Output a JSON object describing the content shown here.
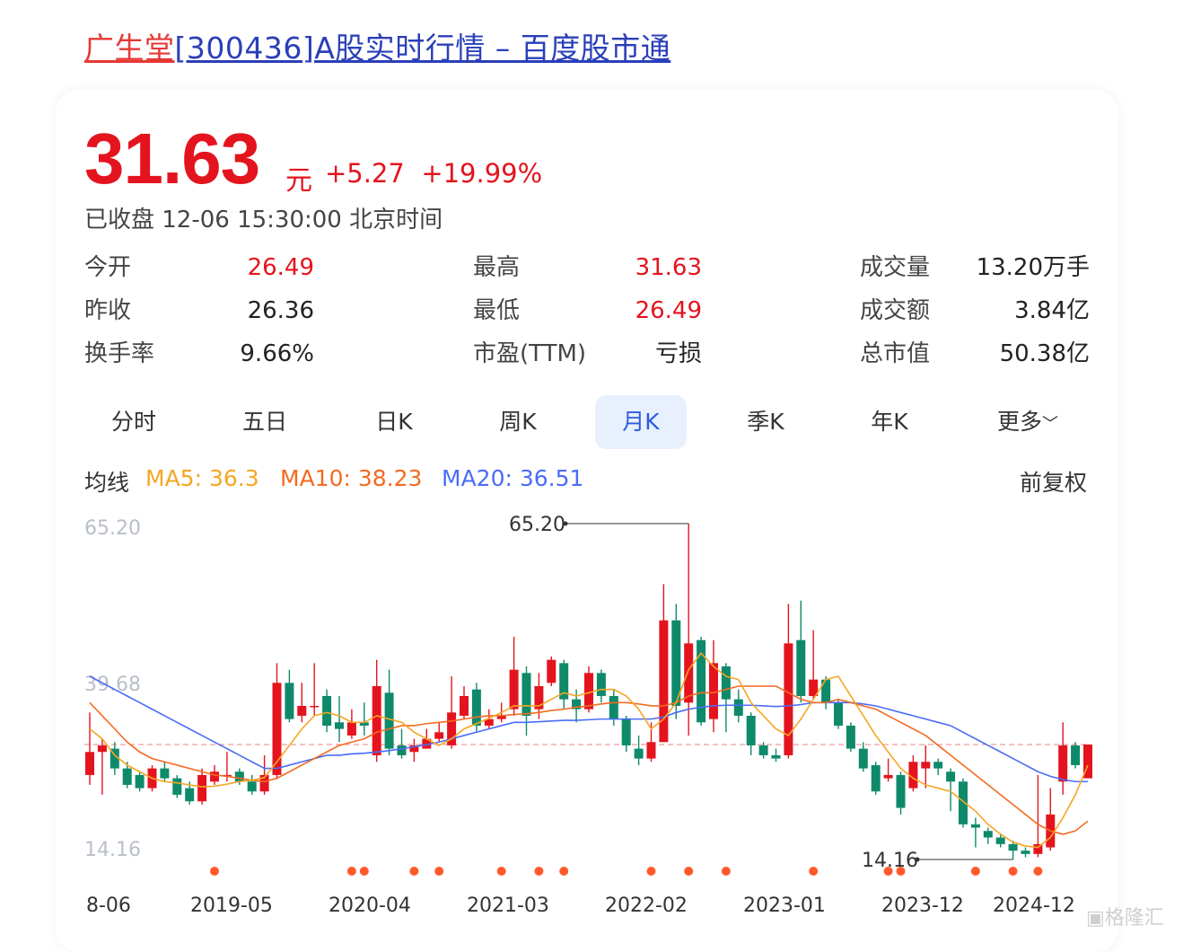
{
  "page_title": {
    "stock_name": "广生堂",
    "rest": "[300436]A股实时行情 – 百度股市通"
  },
  "quote": {
    "price": "31.63",
    "unit": "元",
    "change": "+5.27",
    "change_pct": "+19.99%",
    "status": "已收盘 12-06 15:30:00 北京时间"
  },
  "stats": [
    {
      "label": "今开",
      "value": "26.49",
      "color": "red"
    },
    {
      "label": "最高",
      "value": "31.63",
      "color": "red"
    },
    {
      "label": "成交量",
      "value": "13.20万手",
      "color": "dark"
    },
    {
      "label": "昨收",
      "value": "26.36",
      "color": "dark"
    },
    {
      "label": "最低",
      "value": "26.49",
      "color": "red"
    },
    {
      "label": "成交额",
      "value": "3.84亿",
      "color": "dark"
    },
    {
      "label": "换手率",
      "value": "9.66%",
      "color": "dark"
    },
    {
      "label": "市盈(TTM)",
      "value": "亏损",
      "color": "dark"
    },
    {
      "label": "总市值",
      "value": "50.38亿",
      "color": "dark"
    }
  ],
  "tabs": [
    "分时",
    "五日",
    "日K",
    "周K",
    "月K",
    "季K",
    "年K",
    "更多"
  ],
  "active_tab": "月K",
  "ma_bar": {
    "label": "均线",
    "ma5": "MA5: 36.3",
    "ma10": "MA10: 38.23",
    "ma20": "MA20: 36.51",
    "adjust": "前复权"
  },
  "colors": {
    "up": "#e4141e",
    "down": "#0e8a6b",
    "ma5": "#f5a623",
    "ma10": "#f36b21",
    "ma20": "#4a6cf7",
    "marker": "#ff5a2a"
  },
  "watermark": "格隆汇",
  "chart_data": {
    "type": "candlestick",
    "title": "",
    "ylim": [
      14.16,
      65.2
    ],
    "y_ticks": [
      "65.20",
      "39.68",
      "14.16"
    ],
    "x_ticks": [
      "8-06",
      "2019-05",
      "2020-04",
      "2021-03",
      "2022-02",
      "2023-01",
      "2023-12",
      "2024-12"
    ],
    "high_label": "65.20",
    "low_label": "14.16",
    "last_close": 31.63,
    "candles": [
      [
        27.0,
        30.5,
        36.5,
        25.5
      ],
      [
        30.5,
        31.5,
        32.5,
        24.0
      ],
      [
        31.0,
        28.0,
        32.0,
        27.0
      ],
      [
        28.0,
        25.5,
        29.0,
        25.0
      ],
      [
        27.0,
        25.0,
        27.5,
        24.5
      ],
      [
        25.0,
        28.0,
        28.5,
        24.5
      ],
      [
        28.0,
        26.5,
        29.0,
        26.0
      ],
      [
        26.5,
        24.0,
        27.0,
        23.5
      ],
      [
        25.0,
        23.0,
        26.0,
        22.5
      ],
      [
        23.0,
        27.0,
        28.0,
        22.5
      ],
      [
        26.0,
        27.5,
        28.5,
        25.5
      ],
      [
        27.0,
        27.0,
        30.5,
        26.0
      ],
      [
        27.5,
        26.0,
        28.0,
        25.5
      ],
      [
        26.0,
        24.5,
        27.0,
        24.0
      ],
      [
        24.5,
        27.0,
        30.0,
        24.0
      ],
      [
        27.0,
        41.0,
        44.0,
        26.5
      ],
      [
        41.0,
        35.5,
        43.0,
        35.0
      ],
      [
        36.0,
        37.5,
        41.0,
        35.0
      ],
      [
        37.5,
        37.5,
        44.0,
        36.0
      ],
      [
        39.0,
        34.5,
        40.0,
        33.5
      ],
      [
        35.0,
        34.0,
        39.0,
        32.0
      ],
      [
        33.0,
        35.0,
        37.0,
        32.5
      ],
      [
        35.0,
        34.5,
        38.0,
        33.0
      ],
      [
        30.0,
        40.5,
        44.5,
        29.0
      ],
      [
        39.5,
        31.0,
        43.0,
        30.0
      ],
      [
        31.5,
        30.0,
        34.0,
        29.5
      ],
      [
        30.5,
        31.5,
        32.5,
        29.0
      ],
      [
        31.0,
        32.5,
        34.0,
        31.0
      ],
      [
        32.5,
        33.5,
        35.0,
        32.0
      ],
      [
        31.5,
        36.5,
        42.0,
        31.0
      ],
      [
        36.0,
        39.0,
        40.5,
        35.5
      ],
      [
        40.0,
        34.5,
        41.0,
        33.5
      ],
      [
        34.5,
        35.5,
        37.0,
        34.0
      ],
      [
        35.5,
        36.0,
        38.0,
        35.0
      ],
      [
        37.0,
        43.0,
        48.0,
        36.0
      ],
      [
        42.5,
        36.0,
        43.5,
        33.0
      ],
      [
        37.0,
        40.5,
        42.5,
        35.5
      ],
      [
        41.0,
        44.5,
        45.0,
        40.5
      ],
      [
        44.0,
        38.5,
        44.5,
        37.0
      ],
      [
        38.5,
        37.0,
        40.0,
        35.0
      ],
      [
        37.0,
        42.5,
        43.5,
        36.5
      ],
      [
        42.5,
        39.0,
        43.0,
        38.0
      ],
      [
        39.0,
        35.5,
        40.0,
        34.5
      ],
      [
        35.5,
        31.5,
        36.0,
        30.5
      ],
      [
        31.0,
        29.5,
        33.0,
        28.5
      ],
      [
        29.5,
        32.0,
        35.0,
        29.0
      ],
      [
        32.0,
        50.5,
        56.0,
        32.0
      ],
      [
        50.5,
        37.5,
        53.0,
        35.5
      ],
      [
        38.0,
        47.0,
        65.2,
        33.0
      ],
      [
        47.5,
        35.0,
        48.0,
        34.5
      ],
      [
        35.5,
        44.0,
        47.5,
        33.5
      ],
      [
        43.5,
        38.5,
        44.0,
        33.5
      ],
      [
        38.5,
        36.0,
        40.0,
        35.0
      ],
      [
        36.0,
        31.5,
        36.5,
        30.0
      ],
      [
        31.5,
        30.0,
        32.0,
        29.5
      ],
      [
        30.0,
        29.5,
        31.0,
        29.0
      ],
      [
        30.0,
        47.0,
        53.0,
        29.5
      ],
      [
        47.5,
        39.0,
        53.5,
        38.0
      ],
      [
        39.0,
        41.5,
        49.0,
        38.5
      ],
      [
        41.5,
        38.0,
        42.0,
        37.0
      ],
      [
        38.0,
        34.5,
        38.5,
        34.0
      ],
      [
        34.5,
        31.0,
        35.0,
        30.5
      ],
      [
        31.0,
        28.0,
        32.0,
        27.5
      ],
      [
        28.5,
        24.5,
        29.0,
        24.0
      ],
      [
        26.5,
        27.0,
        29.5,
        26.0
      ],
      [
        27.0,
        22.0,
        27.5,
        21.0
      ],
      [
        25.0,
        29.0,
        30.0,
        24.5
      ],
      [
        28.0,
        29.0,
        31.5,
        25.0
      ],
      [
        29.0,
        28.0,
        29.5,
        27.0
      ],
      [
        27.5,
        26.0,
        28.0,
        21.5
      ],
      [
        26.0,
        19.5,
        26.5,
        19.0
      ],
      [
        19.5,
        19.0,
        20.5,
        16.0
      ],
      [
        18.5,
        17.5,
        19.0,
        16.5
      ],
      [
        17.5,
        16.5,
        18.0,
        16.0
      ],
      [
        16.5,
        15.5,
        17.0,
        14.16
      ],
      [
        15.5,
        15.0,
        16.0,
        14.5
      ],
      [
        15.0,
        16.5,
        27.0,
        14.5
      ],
      [
        16.0,
        21.0,
        25.0,
        15.5
      ],
      [
        26.0,
        31.5,
        35.0,
        24.0
      ],
      [
        31.5,
        28.5,
        32.0,
        28.0
      ],
      [
        26.5,
        31.63,
        31.63,
        26.49
      ]
    ],
    "ma5": [
      34.0,
      32.5,
      30.0,
      28.5,
      27.5,
      26.5,
      26.0,
      25.8,
      25.5,
      25.2,
      25.3,
      25.6,
      26.0,
      26.2,
      26.6,
      29.0,
      31.5,
      34.0,
      36.0,
      36.5,
      36.0,
      35.0,
      35.0,
      36.0,
      35.5,
      35.0,
      33.5,
      32.5,
      31.5,
      32.5,
      34.0,
      34.8,
      35.6,
      36.5,
      37.5,
      37.5,
      37.5,
      38.5,
      39.5,
      39.0,
      39.5,
      40.0,
      40.0,
      39.0,
      37.0,
      34.0,
      35.5,
      38.0,
      43.0,
      45.5,
      43.5,
      42.0,
      41.5,
      38.0,
      36.0,
      34.0,
      33.0,
      35.5,
      38.5,
      41.5,
      42.0,
      39.0,
      36.0,
      33.0,
      30.5,
      28.0,
      26.5,
      25.5,
      25.0,
      24.5,
      23.0,
      21.5,
      19.5,
      18.0,
      16.8,
      16.2,
      16.0,
      17.5,
      20.5,
      24.0,
      28.5
    ],
    "ma10": [
      38.0,
      36.0,
      34.0,
      32.0,
      30.5,
      29.5,
      29.0,
      28.5,
      28.0,
      27.5,
      27.0,
      26.8,
      26.5,
      26.2,
      26.0,
      26.5,
      27.5,
      28.5,
      29.5,
      30.5,
      31.5,
      32.0,
      32.5,
      33.5,
      34.0,
      34.5,
      34.5,
      34.8,
      35.0,
      35.2,
      35.5,
      35.8,
      36.0,
      36.0,
      36.2,
      36.3,
      36.5,
      36.8,
      37.0,
      37.3,
      37.5,
      37.8,
      38.0,
      38.0,
      37.8,
      37.5,
      37.5,
      38.0,
      39.0,
      39.5,
      39.5,
      40.0,
      40.5,
      40.5,
      40.5,
      40.5,
      39.5,
      38.5,
      38.0,
      38.0,
      38.5,
      38.0,
      37.5,
      37.0,
      36.0,
      35.0,
      34.0,
      33.0,
      31.5,
      30.0,
      28.5,
      27.0,
      25.5,
      24.0,
      22.5,
      21.0,
      19.5,
      18.5,
      18.0,
      18.5,
      20.0
    ],
    "ma20": [
      42.0,
      41.0,
      40.0,
      39.0,
      38.0,
      37.0,
      36.0,
      35.0,
      34.0,
      33.0,
      32.0,
      31.0,
      30.0,
      29.0,
      28.0,
      28.0,
      28.5,
      29.0,
      29.5,
      30.0,
      30.0,
      30.2,
      30.3,
      30.5,
      30.7,
      31.0,
      31.3,
      31.6,
      32.0,
      32.5,
      33.0,
      33.5,
      34.0,
      34.5,
      35.0,
      35.0,
      35.1,
      35.2,
      35.3,
      35.3,
      35.4,
      35.5,
      35.5,
      35.5,
      35.5,
      35.5,
      35.8,
      36.5,
      37.0,
      37.3,
      37.5,
      37.6,
      37.6,
      37.6,
      37.5,
      37.4,
      37.5,
      37.7,
      38.0,
      38.0,
      38.0,
      38.0,
      37.8,
      37.5,
      37.0,
      36.5,
      36.0,
      35.5,
      35.0,
      34.5,
      33.5,
      32.5,
      31.5,
      30.5,
      29.5,
      28.5,
      27.5,
      26.8,
      26.3,
      26.0,
      26.0
    ],
    "marker_indices": [
      10,
      21,
      22,
      26,
      28,
      33,
      36,
      38,
      45,
      48,
      51,
      58,
      64,
      65,
      71,
      74,
      76
    ]
  }
}
